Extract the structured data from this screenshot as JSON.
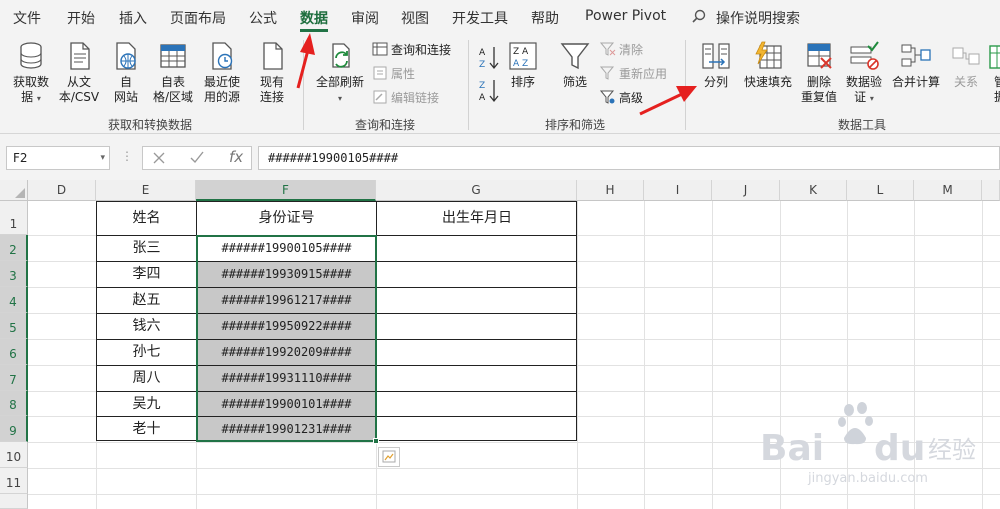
{
  "tabs": [
    {
      "label": "文件"
    },
    {
      "label": "开始"
    },
    {
      "label": "插入"
    },
    {
      "label": "页面布局"
    },
    {
      "label": "公式"
    },
    {
      "label": "数据",
      "active": true
    },
    {
      "label": "审阅"
    },
    {
      "label": "视图"
    },
    {
      "label": "开发工具"
    },
    {
      "label": "帮助"
    },
    {
      "label": "Power Pivot"
    }
  ],
  "search": {
    "label": "操作说明搜索",
    "icon": "search-icon"
  },
  "ribbon": {
    "get_transform": {
      "group_label": "获取和转换数据",
      "get_data": {
        "line1": "获取数",
        "line2": "据",
        "icon": "database-icon"
      },
      "from_text": {
        "line1": "从文",
        "line2": "本/CSV",
        "icon": "text-file-icon"
      },
      "from_web": {
        "line1": "自",
        "line2": "网站",
        "icon": "web-page-icon"
      },
      "from_table": {
        "line1": "自表",
        "line2": "格/区域",
        "icon": "table-icon"
      },
      "recent_sources": {
        "line1": "最近使",
        "line2": "用的源",
        "icon": "recent-sources-icon"
      },
      "existing_connections": {
        "line1": "现有",
        "line2": "连接",
        "icon": "existing-connections-icon"
      }
    },
    "queries_connections": {
      "group_label": "查询和连接",
      "refresh_all": {
        "line1": "全部刷新",
        "icon": "refresh-icon"
      },
      "queries": {
        "label": "查询和连接",
        "icon": "queries-icon",
        "disabled": false
      },
      "properties": {
        "label": "属性",
        "icon": "properties-icon",
        "disabled": true
      },
      "edit_links": {
        "label": "编辑链接",
        "icon": "edit-links-icon",
        "disabled": true
      }
    },
    "sort_filter": {
      "group_label": "排序和筛选",
      "sort_asc": {
        "icon": "sort-asc-icon"
      },
      "sort_desc": {
        "icon": "sort-desc-icon"
      },
      "sort": {
        "label": "排序",
        "icon": "sort-dialog-icon"
      },
      "filter": {
        "label": "筛选",
        "icon": "filter-icon"
      },
      "clear": {
        "label": "清除",
        "icon": "clear-filter-icon",
        "disabled": true
      },
      "reapply": {
        "label": "重新应用",
        "icon": "reapply-icon",
        "disabled": true
      },
      "advanced": {
        "label": "高级",
        "icon": "advanced-filter-icon",
        "disabled": false
      }
    },
    "data_tools": {
      "group_label": "数据工具",
      "text_to_columns": {
        "label": "分列",
        "icon": "text-to-columns-icon"
      },
      "flash_fill": {
        "label": "快速填充",
        "icon": "flash-fill-icon"
      },
      "remove_duplicates": {
        "line1": "删除",
        "line2": "重复值",
        "icon": "remove-duplicates-icon"
      },
      "data_validation": {
        "line1": "数据验",
        "line2": "证",
        "icon": "data-validation-icon"
      },
      "consolidate": {
        "label": "合并计算",
        "icon": "consolidate-icon"
      },
      "relationships": {
        "label": "关系",
        "icon": "relationships-icon",
        "disabled": true
      },
      "manage_model": {
        "line1": "管",
        "line2": "据",
        "icon": "data-model-icon"
      }
    }
  },
  "formula_bar": {
    "name_box": "F2",
    "cancel_icon": "close-icon",
    "enter_icon": "check-icon",
    "fx_label": "fx",
    "content": "######19900105####"
  },
  "grid": {
    "columns": [
      "D",
      "E",
      "F",
      "G",
      "H",
      "I",
      "J",
      "K",
      "L",
      "M"
    ],
    "selected_column": "F",
    "rows": [
      "1",
      "2",
      "3",
      "4",
      "5",
      "6",
      "7",
      "8",
      "9",
      "10",
      "11",
      "12"
    ],
    "selected_rows": [
      "2",
      "3",
      "4",
      "5",
      "6",
      "7",
      "8",
      "9"
    ],
    "table": {
      "headers": [
        "姓名",
        "身份证号",
        "出生年月日"
      ],
      "rows": [
        [
          "张三",
          "######19900105####",
          ""
        ],
        [
          "李四",
          "######19930915####",
          ""
        ],
        [
          "赵五",
          "######19961217####",
          ""
        ],
        [
          "钱六",
          "######19950922####",
          ""
        ],
        [
          "孙七",
          "######19920209####",
          ""
        ],
        [
          "周八",
          "######19931110####",
          ""
        ],
        [
          "吴九",
          "######19900101####",
          ""
        ],
        [
          "老十",
          "######19901231####",
          ""
        ]
      ]
    },
    "active_cell": "F2",
    "selection": "F2:F9"
  },
  "annotations": {
    "arrow_color": "#e5201f"
  },
  "watermark": {
    "brand": "Baidu",
    "product": "经验",
    "url": "jingyan.baidu.com"
  },
  "colors": {
    "accent": "#217346",
    "ribbon_bg": "#f3f3f3",
    "selection_fill": "#c8c8c8"
  }
}
